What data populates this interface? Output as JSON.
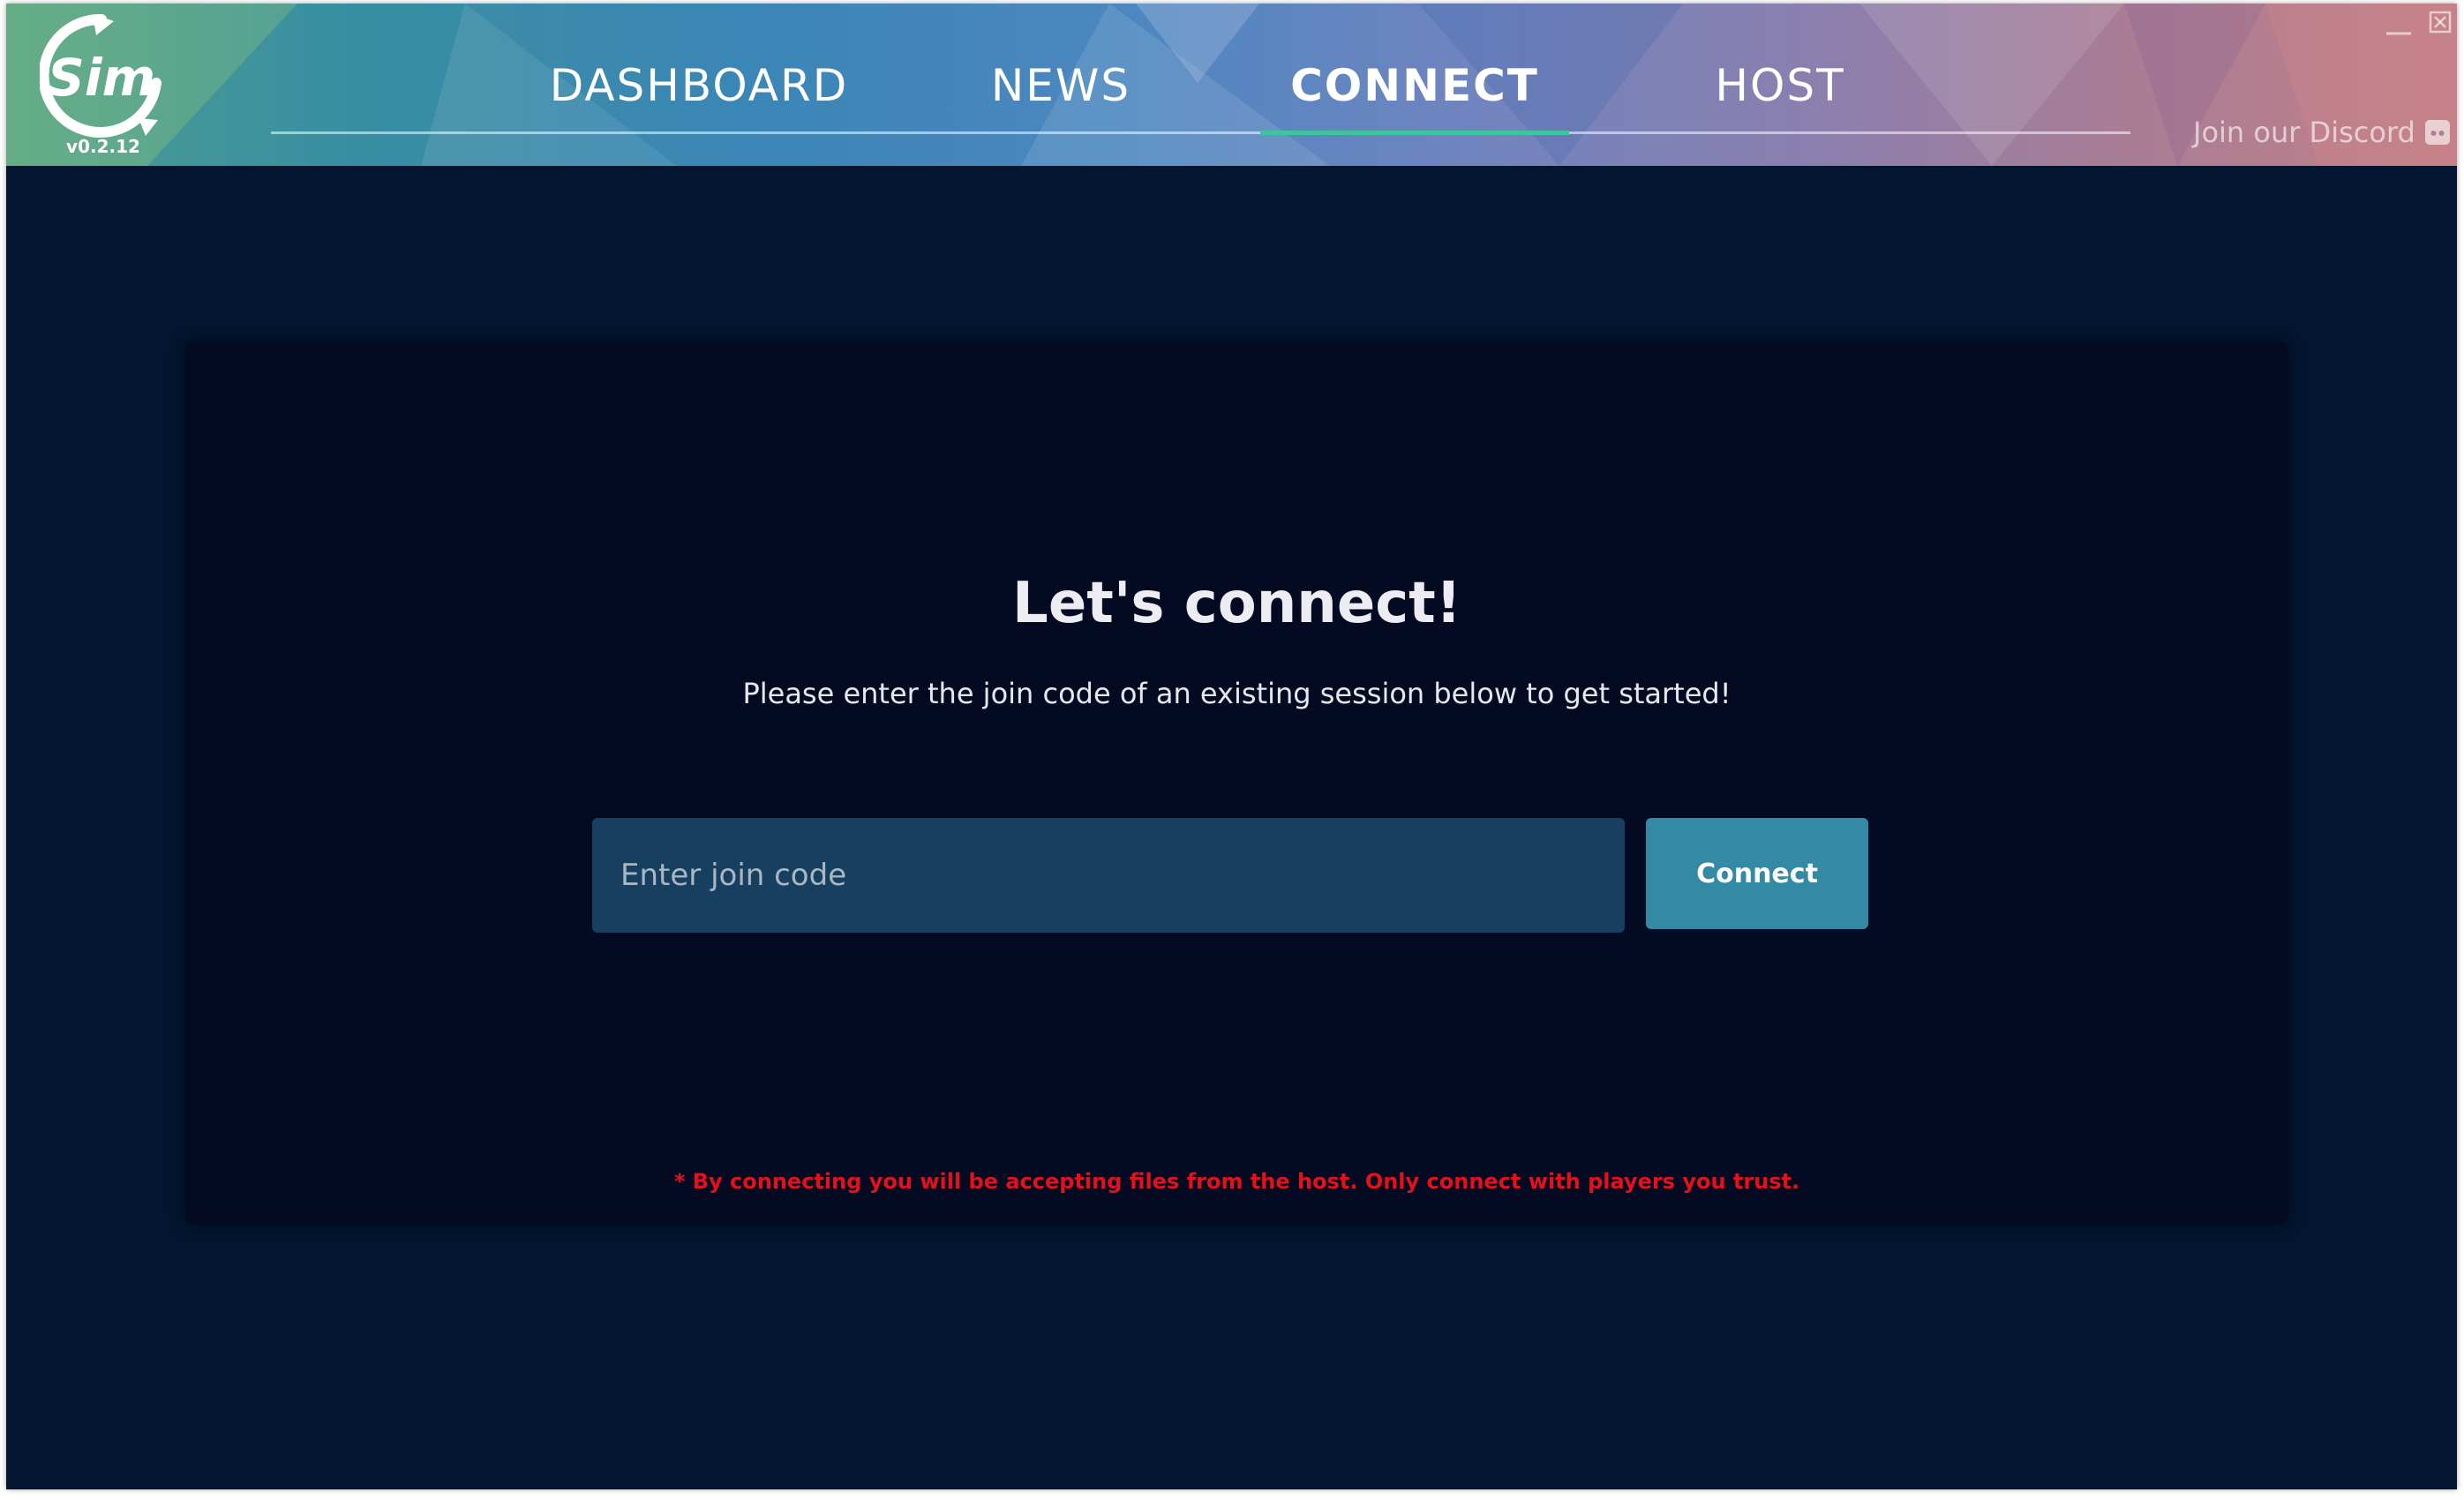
{
  "app": {
    "version": "v0.2.12",
    "logo_text": "Sim"
  },
  "nav": {
    "tabs": [
      {
        "label": "DASHBOARD",
        "active": false
      },
      {
        "label": "NEWS",
        "active": false
      },
      {
        "label": "CONNECT",
        "active": true
      },
      {
        "label": "HOST",
        "active": false
      }
    ],
    "discord_label": "Join our Discord"
  },
  "connect": {
    "title": "Let's connect!",
    "subtitle": "Please enter the join code of an existing session below to get started!",
    "input_placeholder": "Enter join code",
    "input_value": "",
    "button_label": "Connect",
    "warning": "* By connecting you will be accepting files from the host. Only connect with players you trust."
  },
  "icons": {
    "logo": "sim-logo-icon",
    "discord": "discord-icon",
    "minimize": "minimize-icon",
    "close": "close-icon"
  },
  "colors": {
    "background": "#03152f",
    "card": "#040a22",
    "input": "#173f5f",
    "button": "#348aa4",
    "active_tab_underline": "#3fc4a0",
    "warning": "#e3111c"
  }
}
